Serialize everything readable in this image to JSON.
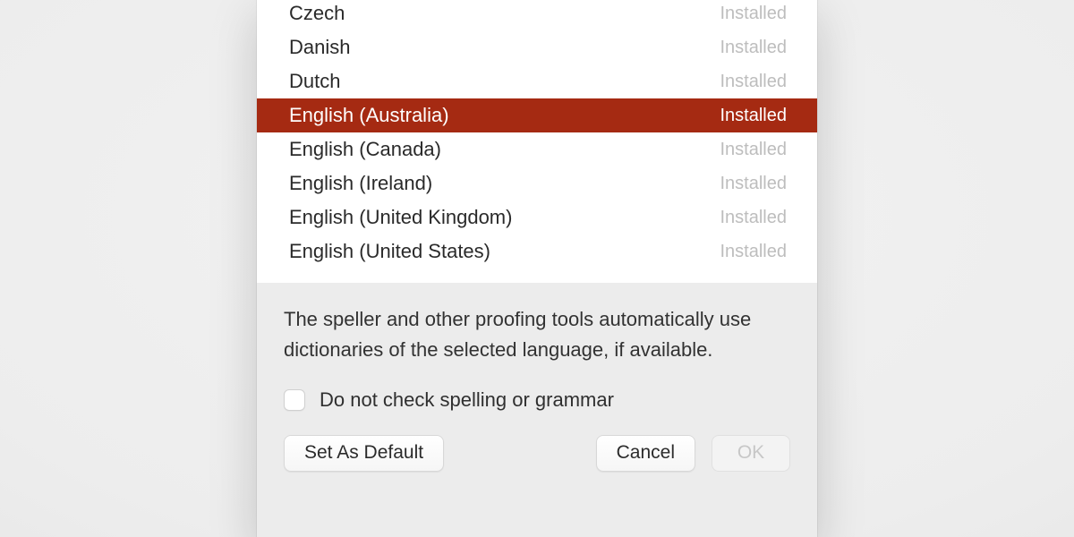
{
  "languages": [
    {
      "name": "Czech",
      "status": "Installed",
      "selected": false
    },
    {
      "name": "Danish",
      "status": "Installed",
      "selected": false
    },
    {
      "name": "Dutch",
      "status": "Installed",
      "selected": false
    },
    {
      "name": "English (Australia)",
      "status": "Installed",
      "selected": true
    },
    {
      "name": "English (Canada)",
      "status": "Installed",
      "selected": false
    },
    {
      "name": "English (Ireland)",
      "status": "Installed",
      "selected": false
    },
    {
      "name": "English (United Kingdom)",
      "status": "Installed",
      "selected": false
    },
    {
      "name": "English (United States)",
      "status": "Installed",
      "selected": false
    }
  ],
  "description": "The speller and other proofing tools automatically use dictionaries of the selected language, if available.",
  "checkbox": {
    "label": "Do not check spelling or grammar",
    "checked": false
  },
  "buttons": {
    "set_default": "Set As Default",
    "cancel": "Cancel",
    "ok": "OK"
  },
  "colors": {
    "selection": "#a52a12"
  }
}
